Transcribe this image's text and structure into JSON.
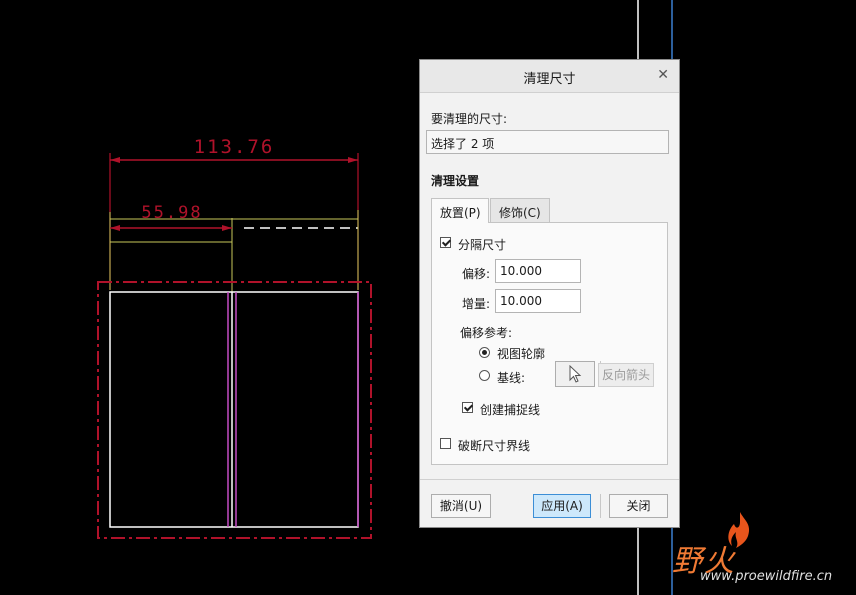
{
  "drawing": {
    "dim_overall": "113.76",
    "dim_left": "55.98"
  },
  "dialog": {
    "title": "清理尺寸",
    "close_icon": "close-icon",
    "to_clean_label": "要清理的尺寸:",
    "selection_value": "选择了 2 项",
    "settings_heading": "清理设置",
    "tabs": [
      {
        "label": "放置(P)",
        "active": true
      },
      {
        "label": "修饰(C)",
        "active": false
      }
    ],
    "placement": {
      "separate_dims_label": "分隔尺寸",
      "separate_dims_checked": true,
      "offset_label": "偏移:",
      "offset_value": "10.000",
      "increment_label": "增量:",
      "increment_value": "10.000",
      "offset_ref_label": "偏移参考:",
      "view_outline_label": "视图轮廓",
      "view_outline_selected": true,
      "baseline_label": "基线:",
      "baseline_selected": false,
      "select_icon": "cursor-arrow-icon",
      "reverse_arrow_label": "反向箭头",
      "create_snap_lines_label": "创建捕捉线",
      "create_snap_lines_checked": true,
      "break_ext_lines_label": "破断尺寸界线",
      "break_ext_lines_checked": false
    },
    "buttons": {
      "undo": "撤消(U)",
      "apply": "应用(A)",
      "close": "关闭"
    }
  },
  "watermark": {
    "brand_cn": "野火",
    "url": "www.proewildfire.cn"
  },
  "colors": {
    "background": "#000000",
    "dim_red": "#b0122a",
    "dim_yellow": "#c8c85a",
    "outline_white": "#ffffff",
    "magenta": "#c44cc4",
    "accent_blue": "#3c8ed6"
  }
}
